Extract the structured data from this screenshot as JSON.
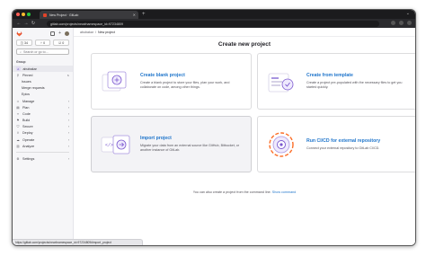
{
  "browser": {
    "tab_title": "New Project · GitLab",
    "url": "gitlab.com/projects/new#namespace_id=97234809",
    "status_url": "https://gitlab.com/projects/new#namespace_id=97234809#import_project"
  },
  "sidebar": {
    "counters": [
      "34",
      "0",
      "0"
    ],
    "search_placeholder": "Search or go to...",
    "context_label": "Group",
    "group_letter": "A",
    "group_name": "abubakar",
    "items": [
      {
        "label": "Pinned",
        "icon": "pin-icon",
        "chevron": "∧"
      },
      {
        "label": "Issues",
        "sub": true
      },
      {
        "label": "Merge requests",
        "sub": true
      },
      {
        "label": "Epics",
        "sub": true
      },
      {
        "label": "Manage",
        "icon": "users-icon",
        "chevron": "›"
      },
      {
        "label": "Plan",
        "icon": "plan-icon",
        "chevron": "›"
      },
      {
        "label": "Code",
        "icon": "code-icon",
        "chevron": "›"
      },
      {
        "label": "Build",
        "icon": "rocket-icon",
        "chevron": "›"
      },
      {
        "label": "Secure",
        "icon": "shield-icon",
        "chevron": "›"
      },
      {
        "label": "Deploy",
        "icon": "deploy-icon",
        "chevron": "›"
      },
      {
        "label": "Operate",
        "icon": "cloud-icon",
        "chevron": "›"
      },
      {
        "label": "Analyze",
        "icon": "chart-icon",
        "chevron": "›"
      }
    ],
    "settings_label": "Settings"
  },
  "breadcrumb": {
    "group": "abubakar",
    "separator": "/",
    "current": "New project"
  },
  "main": {
    "title": "Create new project",
    "cards": [
      {
        "title": "Create blank project",
        "description": "Create a blank project to store your files, plan your work, and collaborate on code, among other things."
      },
      {
        "title": "Create from template",
        "description": "Create a project pre-populated with the necessary files to get you started quickly."
      },
      {
        "title": "Import project",
        "description": "Migrate your data from an external source like GitHub, Bitbucket, or another instance of GitLab."
      },
      {
        "title": "Run CI/CD for external repository",
        "description": "Connect your external repository to GitLab CI/CD."
      }
    ],
    "footer_text": "You can also create a project from the command line.",
    "footer_link": "Show command"
  },
  "colors": {
    "link": "#1f75cb",
    "gitlab_orange": "#e24329",
    "illustration_purple": "#7b58cf"
  }
}
